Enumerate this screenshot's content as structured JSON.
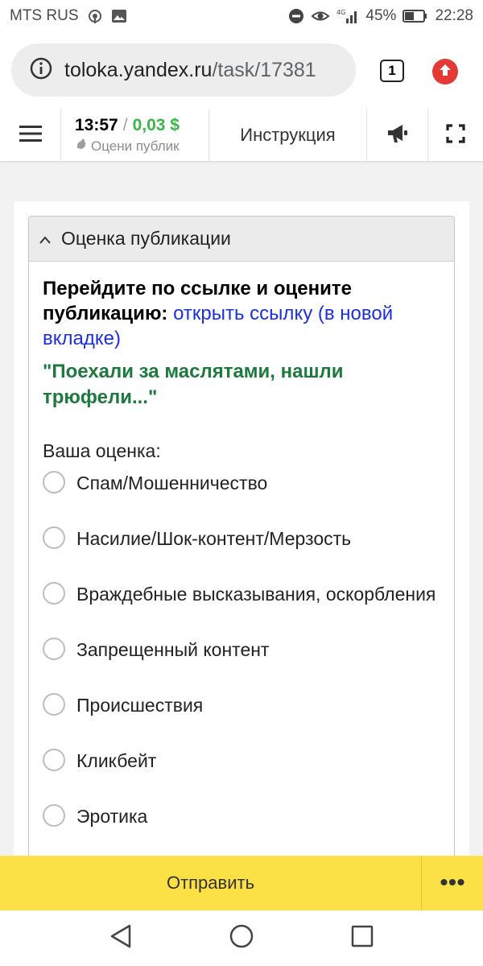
{
  "status_bar": {
    "carrier": "MTS RUS",
    "network": "4G",
    "battery": "45%",
    "time": "22:28"
  },
  "browser": {
    "url_host": "toloka.yandex.ru",
    "url_path": "/task/17381",
    "tab_count": "1",
    "accent_update": "#e53935"
  },
  "toloka_header": {
    "timer": "13:57",
    "separator": "/",
    "reward": "0,03 $",
    "task_name": "Оцени публик",
    "instruction_label": "Инструкция"
  },
  "task": {
    "panel_title": "Оценка публикации",
    "instruction_bold": "Перейдите по ссылке и оцените публикацию:",
    "link_text": "открыть ссылку (в новой вкладке)",
    "publication_title": "\"Поехали за маслятами, нашли трюфели...\"",
    "rating_label": "Ваша оценка:",
    "options": [
      "Спам/Мошенничество",
      "Насилие/Шок-контент/Мерзость",
      "Враждебные высказывания, оскорбления",
      "Запрещенный контент",
      "Происшествия",
      "Кликбейт",
      "Эротика"
    ]
  },
  "actions": {
    "submit_label": "Отправить",
    "more_label": "•••",
    "accent": "#fbe046"
  },
  "colors": {
    "money": "#3bb54a",
    "title_green": "#1d7a3e",
    "link_blue": "#1a2fe0"
  }
}
